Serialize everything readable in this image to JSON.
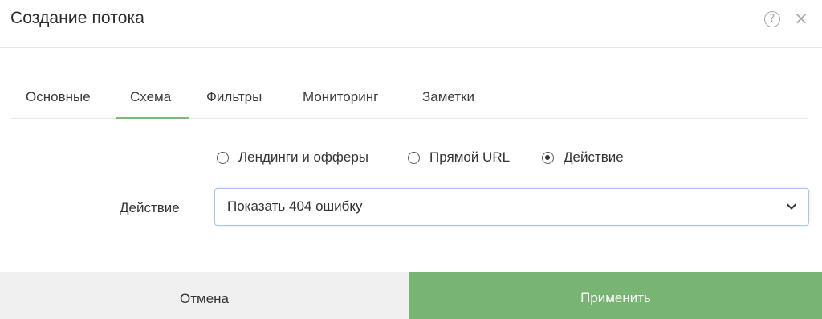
{
  "dialog": {
    "title": "Создание потока"
  },
  "header": {
    "help_icon": "question-circle",
    "help_glyph": "?",
    "close_icon": "close",
    "close_glyph": "×"
  },
  "tabs": [
    {
      "label": "Основные",
      "active": false
    },
    {
      "label": "Схема",
      "active": true
    },
    {
      "label": "Фильтры",
      "active": false
    },
    {
      "label": "Мониторинг",
      "active": false
    },
    {
      "label": "Заметки",
      "active": false
    }
  ],
  "scheme": {
    "options": [
      {
        "label": "Лендинги и офферы",
        "selected": false
      },
      {
        "label": "Прямой URL",
        "selected": false
      },
      {
        "label": "Действие",
        "selected": true
      }
    ],
    "action_field": {
      "label": "Действие",
      "value": "Показать 404 ошибку",
      "icon": "chevron-down"
    }
  },
  "footer": {
    "cancel_label": "Отмена",
    "apply_label": "Применить"
  },
  "colors": {
    "accent": "#78b472",
    "tab_underline": "#7cb87a",
    "select_border": "#a8c7e8",
    "cancel_background": "#f0f0f0"
  }
}
